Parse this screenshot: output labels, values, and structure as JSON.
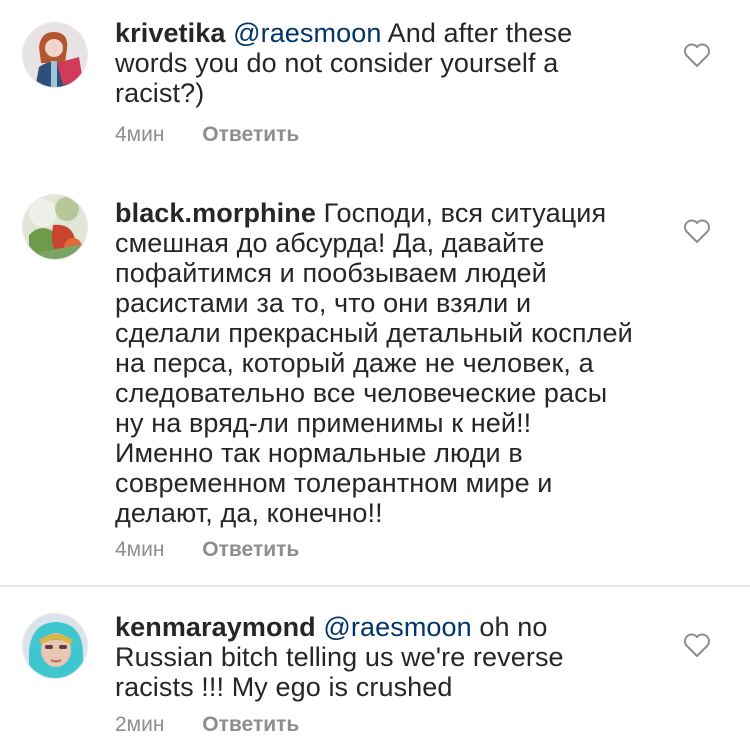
{
  "comments": [
    {
      "username": "krivetika",
      "mention": "@raesmoon",
      "text": "And after these words you do not consider yourself a racist?)",
      "time": "4мин",
      "reply_label": "Ответить",
      "like_icon": "heart-outline-icon"
    },
    {
      "username": "black.morphine",
      "mention": "",
      "text": "Господи, вся ситуация смешная до абсурда! Да, давайте пофайтимся и пообзываем людей расистами за то, что они взяли и сделали прекрасный детальный косплей на перса, который даже не человек, а следовательно все человеческие расы ну на вряд-ли применимы к ней!! Именно так нормальные люди в современном толерантном мире и делают, да, конечно!!",
      "time": "4мин",
      "reply_label": "Ответить",
      "like_icon": "heart-outline-icon"
    },
    {
      "username": "kenmaraymond",
      "mention": "@raesmoon",
      "text": "oh no Russian bitch telling us we're reverse racists !!! My ego is crushed",
      "time": "2мин",
      "reply_label": "Ответить",
      "like_icon": "heart-outline-icon"
    }
  ],
  "colors": {
    "text": "#262626",
    "mention": "#003569",
    "meta": "#8e8e8e",
    "divider": "#e6e6e6"
  }
}
